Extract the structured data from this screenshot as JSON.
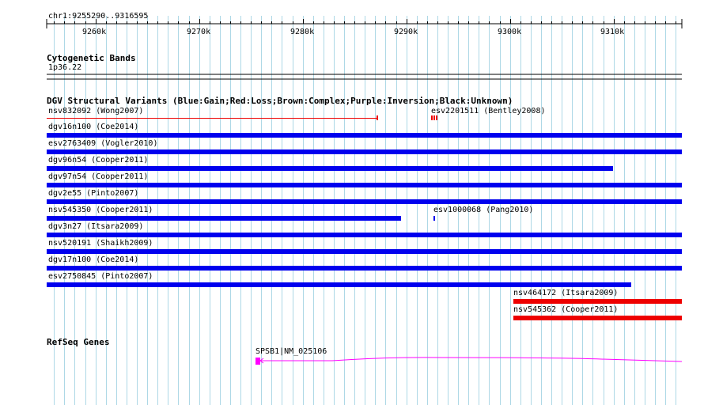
{
  "ruler": {
    "region": "chr1:9255290..9316595",
    "ticks": [
      "9260k",
      "9270k",
      "9280k",
      "9290k",
      "9300k",
      "9310k"
    ]
  },
  "cytobands": {
    "heading": "Cytogenetic Bands",
    "band": "1p36.22"
  },
  "dgv": {
    "heading": "DGV Structural Variants (Blue:Gain;Red:Loss;Brown:Complex;Purple:Inversion;Black:Unknown)",
    "colors": {
      "gain": "#0000ee",
      "loss": "#ee0000",
      "complex": "#8b4513",
      "inversion": "#800080",
      "unknown": "#000000"
    },
    "variants": [
      {
        "label": "nsv832092 (Wong2007)",
        "type": "loss",
        "style": "thin"
      },
      {
        "label": "esv2201511 (Bentley2008)",
        "type": "loss",
        "style": "ticks"
      },
      {
        "label": "dgv16n100 (Coe2014)",
        "type": "gain",
        "style": "bar"
      },
      {
        "label": "esv2763409 (Vogler2010)",
        "type": "gain",
        "style": "bar"
      },
      {
        "label": "dgv96n54 (Cooper2011)",
        "type": "gain",
        "style": "bar"
      },
      {
        "label": "dgv97n54 (Cooper2011)",
        "type": "gain",
        "style": "bar"
      },
      {
        "label": "dgv2e55 (Pinto2007)",
        "type": "gain",
        "style": "bar"
      },
      {
        "label": "nsv545350 (Cooper2011)",
        "type": "gain",
        "style": "bar"
      },
      {
        "label": "esv1000068 (Pang2010)",
        "type": "gain",
        "style": "bar"
      },
      {
        "label": "dgv3n27 (Itsara2009)",
        "type": "gain",
        "style": "bar"
      },
      {
        "label": "nsv520191 (Shaikh2009)",
        "type": "gain",
        "style": "bar"
      },
      {
        "label": "dgv17n100 (Coe2014)",
        "type": "gain",
        "style": "bar"
      },
      {
        "label": "esv2750845 (Pinto2007)",
        "type": "gain",
        "style": "bar"
      },
      {
        "label": "nsv464172 (Itsara2009)",
        "type": "loss",
        "style": "bar"
      },
      {
        "label": "nsv545362 (Cooper2011)",
        "type": "loss",
        "style": "bar"
      }
    ]
  },
  "refseq": {
    "heading": "RefSeq Genes",
    "gene_label": "SPSB1|NM_025106",
    "gene_color": "#ff00ff"
  },
  "colors": {
    "grid": "#add8e6",
    "text": "#000000"
  }
}
